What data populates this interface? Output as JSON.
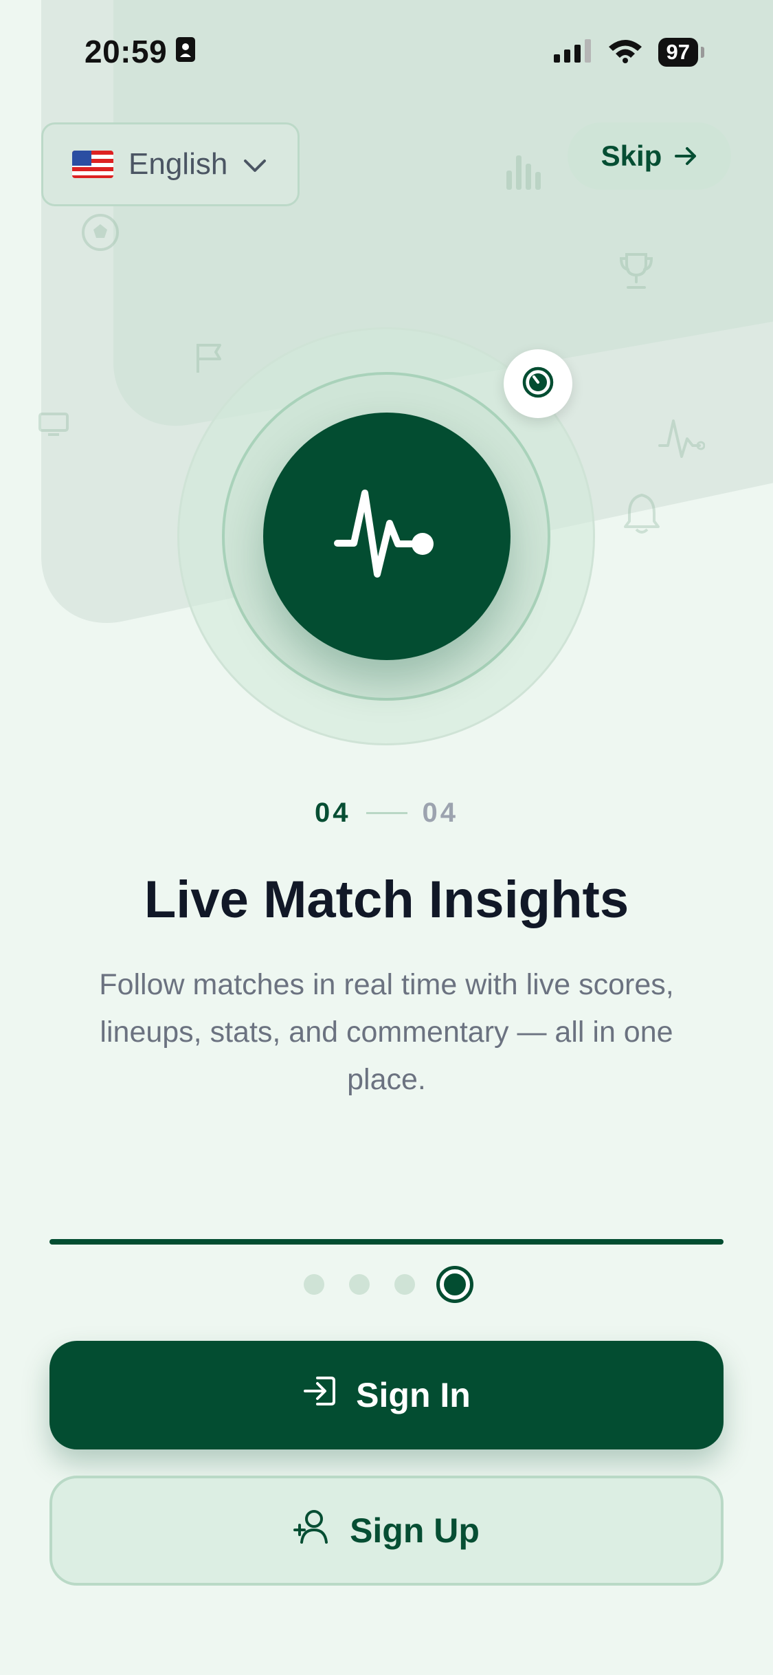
{
  "status_bar": {
    "time": "20:59",
    "battery": "97"
  },
  "language": {
    "flag": "US flag",
    "label": "English"
  },
  "skip": {
    "label": "Skip"
  },
  "pager": {
    "current": "04",
    "total": "04"
  },
  "slide": {
    "title": "Live Match Insights",
    "description": "Follow matches in real time with live scores, lineups, stats, and commentary — all in one place."
  },
  "progress": {
    "fraction": 1.0,
    "dots": 4,
    "active_index": 3
  },
  "buttons": {
    "sign_in": "Sign In",
    "sign_up": "Sign Up"
  },
  "colors": {
    "brand": "#034d31",
    "background": "#eef7f1",
    "accent_light": "#cfe4d7"
  }
}
